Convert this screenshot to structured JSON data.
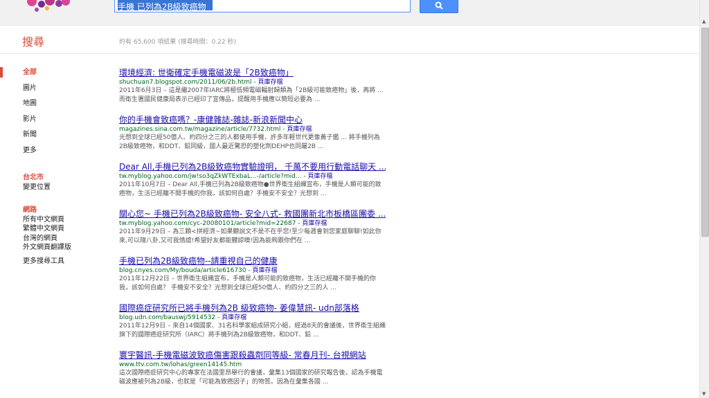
{
  "header": {
    "search_value": "手機 已列為2B級致癌物",
    "search_icon": "magnifier"
  },
  "toolbar": {
    "brand": "搜尋",
    "result_stats": "約有 65,600 項結果 (搜尋時間：0.22 秒)"
  },
  "sidebar": {
    "nav": [
      {
        "label": "全部",
        "active": true
      },
      {
        "label": "圖片",
        "active": false
      },
      {
        "label": "地圖",
        "active": false
      },
      {
        "label": "影片",
        "active": false
      },
      {
        "label": "新聞",
        "active": false
      },
      {
        "label": "更多",
        "active": false
      }
    ],
    "location": {
      "title": "台北市",
      "change": "變更位置"
    },
    "web": {
      "title": "網路",
      "items": [
        "所有中文網頁",
        "繁體中文網頁",
        "台灣的網頁",
        "外文網頁翻譯版"
      ]
    },
    "more_tools": "更多搜尋工具"
  },
  "results": [
    {
      "title": "環境經濟: 世衛確定手機電磁波是「2B致癌物」",
      "url": "shuchuan7.blogspot.com/2011/06/2b.html",
      "cache": "頁庫存檔",
      "snippet": "2011年6月3日 – 這是繼2007年IARC將極低頻電磁輻射歸類為「2B級可能致癌物」後，再將 ... 而衛生署國民健康局表示已經印了宣傳品，提醒用手機應以簡短必要為 ..."
    },
    {
      "title": "你的手機會致癌嗎？-康健雜誌-雜誌-新浪新聞中心",
      "url": "magazines.sina.com.tw/magazine/article/7732.html",
      "cache": "頁庫存檔",
      "snippet": "光想到全球已經50億人、約四分之三的人都使用手機，許多年輕世代更像黃子鑑 ... 將手機列為2B級致癌物，和DDT、鉛同級，國人最近驚恐的塑化劑DEHP也同屬2B ..."
    },
    {
      "title": "Dear All,手機已列為2B級致癌物實驗證明， 千萬不要用行動電話聊天 ...",
      "url": "tw.myblog.yahoo.com/jw!so3qZkWTExbaL...-/article?mid...",
      "cache": "頁庫存檔",
      "snippet": "2011年10月7日 – Dear All,手機已列為2B級致癌物●世界衛生組織宣布，手機是人類可能的致癌物，生活已經離不開手機的你我，該如何自處？手機安不安全？光想到 ..."
    },
    {
      "title": "關心您~ 手機已列為2B級致癌物- 安全八式- 救國團新北市板橋區團委 ...",
      "url": "tw.myblog.yahoo.com/cyc-20080101/article?mid=22687",
      "cache": "頁庫存檔",
      "snippet": "2011年9月29日 – 為三顆<拼經濟~如果聽說文不是不在乎您!至少每週會到您家庭聊聊!如此你來,可以隨八卦,又可我情誼!希望好友都能體諒噢!因為能夠跟你們在 ..."
    },
    {
      "title": "手機已列為2B級致癌物--請重視自己的健康",
      "url": "blog.cnyes.com/My/bouda/article616730",
      "cache": "頁庫存檔",
      "snippet": "2011年12月22日 – 世界衛生組織宣布，手機是人類可能的致癌物，生活已經離不開手機的你我，該如何自處？ 手機安不安全？光想到全球已經50億人、約四分之三的人 ..."
    },
    {
      "title": "國際癌症研究所已將手機列為2B 級致癌物- 姜偉慧訊- udn部落格",
      "url": "blog.udn.com/bauswj/5914532",
      "cache": "頁庫存檔",
      "snippet": "2011年12月9日 – 來自14個國家、31名科學家組成研究小組，經過8天的會議後，世界衛生組織旗下的國際癌症研究所（IARC）將手機列為2B級致癌物，和DDT、鉛 ..."
    },
    {
      "title": "寰宇醫訊-手機電磁波致癌傷害跟殺蟲劑同等級- 常春月刊- 台視網站",
      "url": "www.ttv.com.tw/lohas/green14145.htm",
      "cache": "",
      "snippet": "這次國際癌症研究中心的專家在法國里昂舉行的會議，彙集13個國家的研究報告後，認為手機電磁波應被列為2B級，也就是「可能為致癌因子」的物質。因為在彙集各國 ..."
    }
  ]
}
